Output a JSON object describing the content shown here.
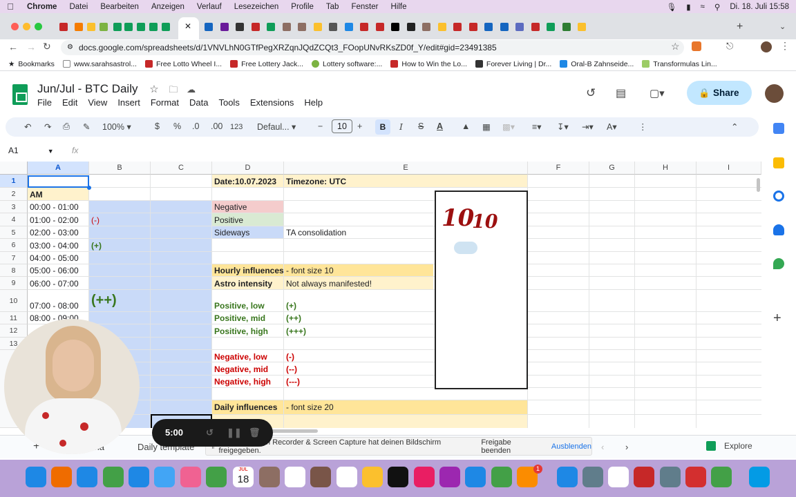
{
  "menubar": {
    "app": "Chrome",
    "items": [
      "Datei",
      "Bearbeiten",
      "Anzeigen",
      "Verlauf",
      "Lesezeichen",
      "Profile",
      "Tab",
      "Fenster",
      "Hilfe"
    ],
    "clock": "Di. 18. Juli  15:58"
  },
  "browser": {
    "url": "docs.google.com/spreadsheets/d/1VNVLhN0GTfPegXRZqnJQdZCQt3_FOopUNvRKsZD0f_Y/edit#gid=23491385",
    "bookmarks": [
      "Bookmarks",
      "www.sarahsastrol...",
      "Free Lotto Wheel I...",
      "Free Lottery Jack...",
      "Lottery software:...",
      "How to Win the Lo...",
      "Forever Living | Dr...",
      "Oral-B Zahnseide...",
      "Transformulas Lin..."
    ],
    "colors": {
      "accent": "#1a73e8"
    }
  },
  "sheets": {
    "title": "Jun/Jul - BTC Daily",
    "menu": [
      "File",
      "Edit",
      "View",
      "Insert",
      "Format",
      "Data",
      "Tools",
      "Extensions",
      "Help"
    ],
    "share": "Share",
    "toolbar": {
      "zoom": "100%",
      "currency": "$",
      "percent": "%",
      "dec_down": ".0",
      "dec_up": ".00",
      "number_format": "123",
      "font": "Defaul...",
      "font_size": "10",
      "bold": "B",
      "italic": "I",
      "strike": "S",
      "text_color": "A"
    },
    "namebox": "A1",
    "fx": "fx",
    "columns": [
      "A",
      "B",
      "C",
      "D",
      "E",
      "F",
      "G",
      "H",
      "I"
    ],
    "rows": [
      "1",
      "2",
      "3",
      "4",
      "5",
      "6",
      "7",
      "8",
      "9",
      "10",
      "11",
      "12",
      "13"
    ],
    "cells": {
      "d1": "Date:10.07.2023",
      "e1": "Timezone: UTC",
      "a2": "AM",
      "a3": "00:00 - 01:00",
      "a4": "01:00 - 02:00",
      "a5": "02:00 - 03:00",
      "a6": "03:00 - 04:00",
      "a7": "04:00 - 05:00",
      "a8": "05:00 - 06:00",
      "a9": "06:00 - 07:00",
      "a10": "07:00 - 08:00",
      "a11": "08:00 - 09:00",
      "b4": "(-)",
      "b6": "(+)",
      "b10": "(++)",
      "d3": "Negative",
      "d4": "Positive",
      "d5": "Sideways",
      "e5": "TA consolidation",
      "d8": "Hourly influences",
      "e8": "- font size 10",
      "d9": "Astro intensity",
      "e9": "Not always manifested!",
      "d10": "Positive, low",
      "e10": "(+)",
      "d11": "Positive, mid",
      "e11": "(++)",
      "d12": "Positive, high",
      "e12": "(+++)",
      "d14": "Negative, low",
      "e14": "(-)",
      "d15": "Negative, mid",
      "e15": "(--)",
      "d16": "Negative, high",
      "e16": "(---)",
      "d18": "Daily influences",
      "e18": "- font size 20"
    },
    "drawing": {
      "big": "10",
      "small": "10"
    },
    "sheet_tabs": [
      "sha",
      "Daily template"
    ],
    "explore": "Explore"
  },
  "loom": {
    "timer": "5:00",
    "message": "Loom – Screen Recorder & Screen Capture hat deinen Bildschirm freigegeben.",
    "stop": "Freigabe beenden",
    "hide": "Ausblenden"
  },
  "dock": {
    "calendar_day": "18",
    "calendar_month": "JUL",
    "badge": "1"
  }
}
